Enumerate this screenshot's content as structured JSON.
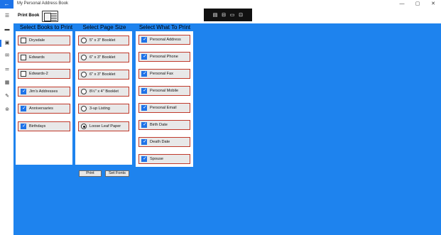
{
  "window": {
    "title": "My Personal Address Book",
    "back_glyph": "←",
    "controls": [
      "—",
      "▢",
      "✕"
    ]
  },
  "header": {
    "page_title": "Print Book",
    "print_icon": "print-book-icon"
  },
  "toolbar": {
    "icons": [
      "▤",
      "⊟",
      "▭",
      "⊡"
    ]
  },
  "nav": {
    "icons": [
      "☰",
      "▬",
      "▣",
      "✉",
      "⚌",
      "▦",
      "✎",
      "⊚"
    ]
  },
  "books": {
    "heading": "Select Books to Print",
    "items": [
      {
        "label": "Drysdale",
        "checked": false
      },
      {
        "label": "Edwards",
        "checked": false
      },
      {
        "label": "Edwards-2",
        "checked": false
      },
      {
        "label": "Jim's Addresses",
        "checked": true
      },
      {
        "label": "Anniversaries",
        "checked": true
      },
      {
        "label": "Birthdays",
        "checked": true
      }
    ]
  },
  "page_size": {
    "heading": "Select Page Size",
    "items": [
      {
        "label": "5\" x 3\" Booklet",
        "selected": false
      },
      {
        "label": "6\" x 3\" Booklet",
        "selected": false
      },
      {
        "label": "6\" x 3\" Booklet",
        "selected": false
      },
      {
        "label": "8½\" x 4\" Booklet",
        "selected": false
      },
      {
        "label": "3-up Listing",
        "selected": false
      },
      {
        "label": "Loose Leaf Paper",
        "selected": true
      }
    ]
  },
  "what_to_print": {
    "heading": "Select What To Print",
    "items": [
      {
        "label": "Personal Address",
        "checked": true
      },
      {
        "label": "Personal Phone",
        "checked": true
      },
      {
        "label": "Personal Fax",
        "checked": true
      },
      {
        "label": "Personal Mobile",
        "checked": true
      },
      {
        "label": "Personal Email",
        "checked": true
      },
      {
        "label": "Birth Date",
        "checked": true
      },
      {
        "label": "Death Date",
        "checked": true
      },
      {
        "label": "Spouse",
        "checked": true
      }
    ]
  },
  "actions": {
    "print_label": "Print",
    "fonts_label": "Set Fonts"
  },
  "colors": {
    "accent": "#1e73e8",
    "background": "#1e83ee",
    "border": "#c0392b"
  }
}
